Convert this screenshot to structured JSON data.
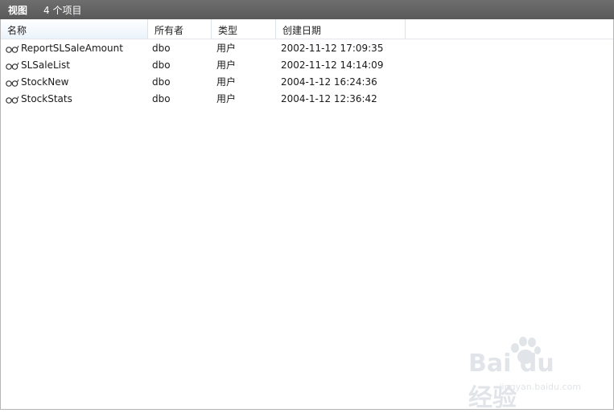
{
  "titlebar": {
    "title": "视图",
    "count": "4 个项目"
  },
  "columns": [
    {
      "label": "名称",
      "sorted": true,
      "sort_direction": "ascending"
    },
    {
      "label": "所有者"
    },
    {
      "label": "类型"
    },
    {
      "label": "创建日期"
    }
  ],
  "rows": [
    {
      "name": "ReportSLSaleAmount",
      "owner": "dbo",
      "type": "用户",
      "created": "2002-11-12 17:09:35",
      "icon": "view-glasses-icon"
    },
    {
      "name": "SLSaleList",
      "owner": "dbo",
      "type": "用户",
      "created": "2002-11-12 14:14:09",
      "icon": "view-glasses-icon"
    },
    {
      "name": "StockNew",
      "owner": "dbo",
      "type": "用户",
      "created": "2004-1-12 16:24:36",
      "icon": "view-glasses-icon"
    },
    {
      "name": "StockStats",
      "owner": "dbo",
      "type": "用户",
      "created": "2004-1-12 12:36:42",
      "icon": "view-glasses-icon"
    }
  ],
  "watermark": {
    "logo": "Bai du 经验",
    "url": "jingyan.baidu.com"
  },
  "colors": {
    "titlebar": "#5f5f5f",
    "sorted_header": "#eaf3fb",
    "text": "#1a1a1a"
  }
}
